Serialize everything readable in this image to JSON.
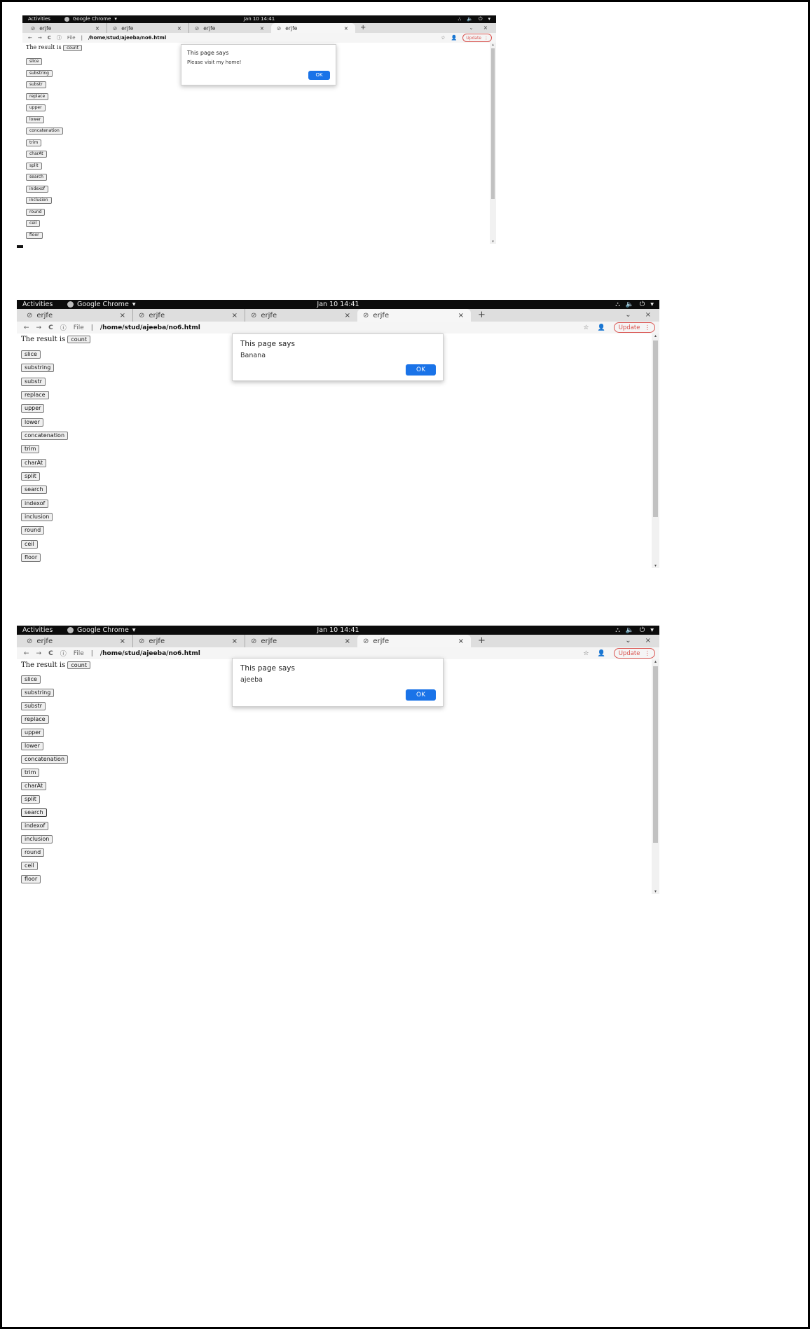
{
  "doc_header_text": "",
  "system_bar": {
    "activities": "Activities",
    "app_name": "Google Chrome",
    "clock": "Jan 10  14:41"
  },
  "tabs": [
    {
      "title": "erjfe"
    },
    {
      "title": "erjfe"
    },
    {
      "title": "erjfe"
    },
    {
      "title": "erjfe"
    }
  ],
  "address_bar": {
    "scheme": "File",
    "url": "/home/stud/ajeeba/no6.html",
    "update_label": "Update"
  },
  "page": {
    "result_prefix": "The result is",
    "count_label": "count",
    "buttons": [
      "slice",
      "substring",
      "substr",
      "replace",
      "upper",
      "lower",
      "concatenation",
      "trim",
      "charAt",
      "split",
      "search",
      "indexof",
      "inclusion",
      "round",
      "ceil",
      "floor"
    ]
  },
  "dialogs": [
    {
      "title": "This page says",
      "message": "Please visit my home!",
      "ok": "OK"
    },
    {
      "title": "This page says",
      "message": "Banana",
      "ok": "OK"
    },
    {
      "title": "This page says",
      "message": "ajeeba",
      "ok": "OK"
    }
  ],
  "colors": {
    "accent_blue": "#1a73e8",
    "update_red": "#d9534f",
    "system_bar_bg": "#0c0c0c"
  }
}
